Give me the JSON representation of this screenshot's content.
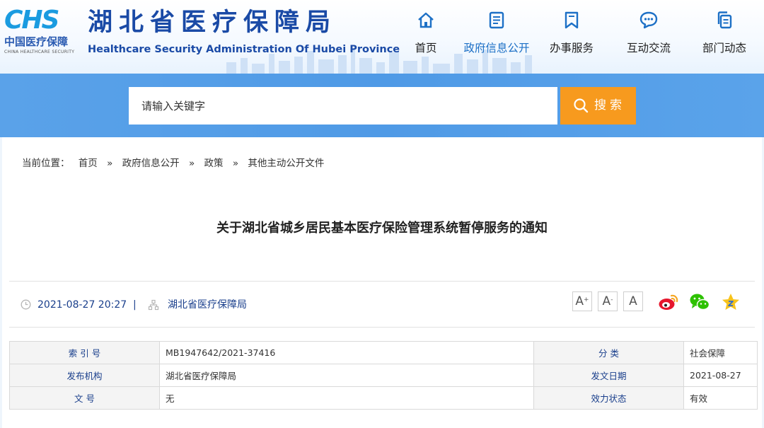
{
  "header": {
    "logo_mark": "CHS",
    "logo_cn": "中国医疗保障",
    "logo_en": "CHINA HEALTHCARE SECURITY",
    "title_cn": "湖北省医疗保障局",
    "title_en": "Healthcare Security Administration Of Hubei Province",
    "brand_color": "#1a4aa6"
  },
  "nav": {
    "items": [
      {
        "label": "首页",
        "icon": "home-icon"
      },
      {
        "label": "政府信息公开",
        "icon": "document-list-icon",
        "active": true
      },
      {
        "label": "办事服务",
        "icon": "bookmark-icon"
      },
      {
        "label": "互动交流",
        "icon": "chat-bubble-icon"
      },
      {
        "label": "部门动态",
        "icon": "copy-icon"
      }
    ],
    "active_color": "#1d70c6"
  },
  "search": {
    "placeholder": "请输入关键字",
    "button_label": "搜索",
    "button_color": "#f79a1e"
  },
  "breadcrumb": {
    "prefix": "当前位置：",
    "items": [
      "首页",
      "政府信息公开",
      "政策",
      "其他主动公开文件"
    ],
    "separator": "»"
  },
  "article": {
    "title": "关于湖北省城乡居民基本医疗保险管理系统暂停服务的通知",
    "date": "2021-08-27 20:27",
    "divider": "|",
    "source": "湖北省医疗保障局"
  },
  "tools": {
    "font_sizes": [
      {
        "glyph": "A",
        "sup": "+"
      },
      {
        "glyph": "A",
        "sup": "-"
      },
      {
        "glyph": "A",
        "sup": ""
      }
    ],
    "share": [
      "weibo-icon",
      "wechat-icon",
      "favorite-star-icon"
    ]
  },
  "info_table": [
    {
      "label1": "索 引 号",
      "value1": "MB1947642/2021-37416",
      "label2": "分 类",
      "value2": "社会保障"
    },
    {
      "label1": "发布机构",
      "value1": "湖北省医疗保障局",
      "label2": "发文日期",
      "value2": "2021-08-27"
    },
    {
      "label1": "文 号",
      "value1": "无",
      "label2": "效力状态",
      "value2": "有效"
    }
  ]
}
